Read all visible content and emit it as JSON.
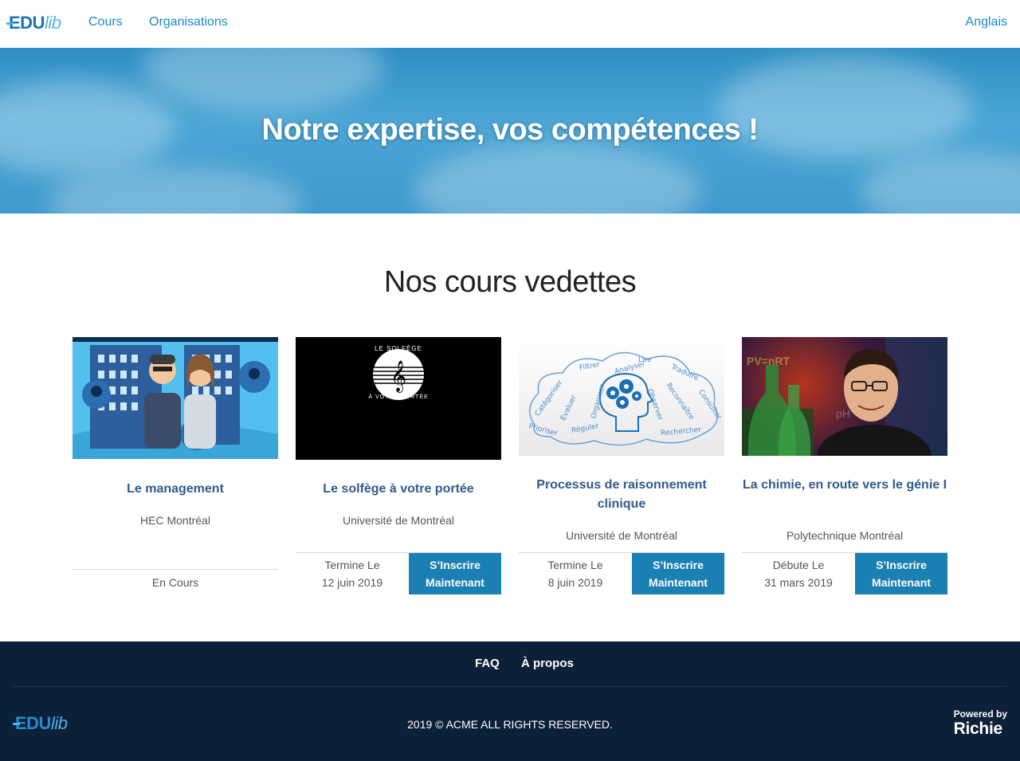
{
  "header": {
    "logo_main": "EDU",
    "logo_accent": "lib",
    "nav": [
      "Cours",
      "Organisations"
    ],
    "language": "Anglais"
  },
  "hero": {
    "title": "Notre expertise, vos compétences !"
  },
  "section": {
    "title": "Nos cours vedettes"
  },
  "courses": [
    {
      "title": "Le management",
      "organization": "HEC Montréal",
      "status": "En Cours"
    },
    {
      "title": "Le solfège à votre portée",
      "organization": "Université de Montréal",
      "date_label": "Termine Le",
      "date": "12 juin 2019",
      "cta": [
        "S’Inscrire",
        "Maintenant"
      ],
      "thumb_text": [
        "LE SOLFÈGE",
        "À VOTRE PORTÉE"
      ]
    },
    {
      "title": "Processus de raisonnement clinique",
      "organization": "Université de Montréal",
      "date_label": "Termine Le",
      "date": "8 juin 2019",
      "cta": [
        "S’Inscrire",
        "Maintenant"
      ],
      "thumb_words": [
        "Lire",
        "Filtrer",
        "Analyser",
        "Traduire",
        "Catégoriser",
        "Évaluer",
        "Organiser",
        "Observer",
        "Reconnaître",
        "Consulter",
        "Prioriser",
        "Réguler",
        "Rechercher"
      ]
    },
    {
      "title": "La chimie, en route vers le génie I",
      "organization": "Polytechnique Montréal",
      "date_label": "Débute Le",
      "date": "31 mars 2019",
      "cta": [
        "S’Inscrire",
        "Maintenant"
      ],
      "thumb_text": [
        "PV=nRT",
        "pH"
      ]
    }
  ],
  "footer": {
    "links": [
      "FAQ",
      "À propos"
    ],
    "logo_main": "EDU",
    "logo_accent": "lib",
    "copyright": "2019 © ACME ALL RIGHTS RESERVED.",
    "powered_by": "Powered by",
    "powered_brand": "Richie"
  },
  "colors": {
    "brand": "#1a87c9",
    "cta": "#1a7fb3",
    "footer_bg": "#0c2038",
    "card_title": "#2f5a8c"
  }
}
